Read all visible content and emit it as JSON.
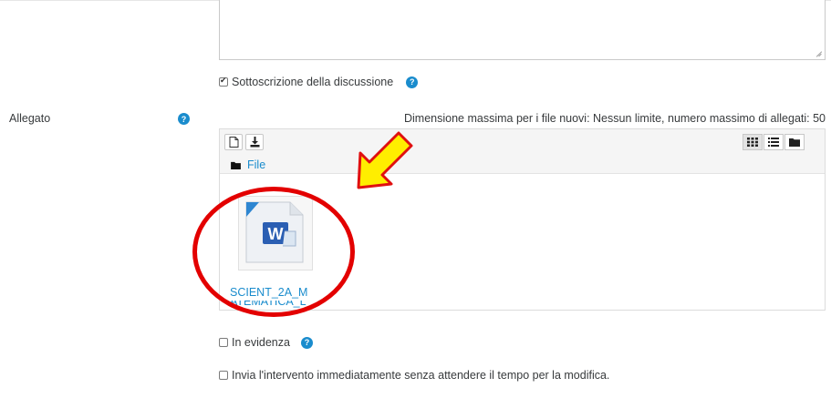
{
  "form": {
    "subscription_label": "Sottoscrizione della discussione",
    "allegato_label": "Allegato",
    "max_size_text": "Dimensione massima per i file nuovi: Nessun limite, numero massimo di allegati: 50",
    "highlight_label": "In evidenza",
    "send_now_label": "Invia l'intervento immediatamente senza attendere il tempo per la modifica."
  },
  "filepicker": {
    "breadcrumb": "File",
    "file_name_line1": "SCIENT_2A_M",
    "file_name_line2": "ATEMATICA_L"
  },
  "help_icon": "?",
  "colors": {
    "accent": "#1a8ccd",
    "annotation_red": "#e30000",
    "annotation_yellow": "#ffee00"
  }
}
